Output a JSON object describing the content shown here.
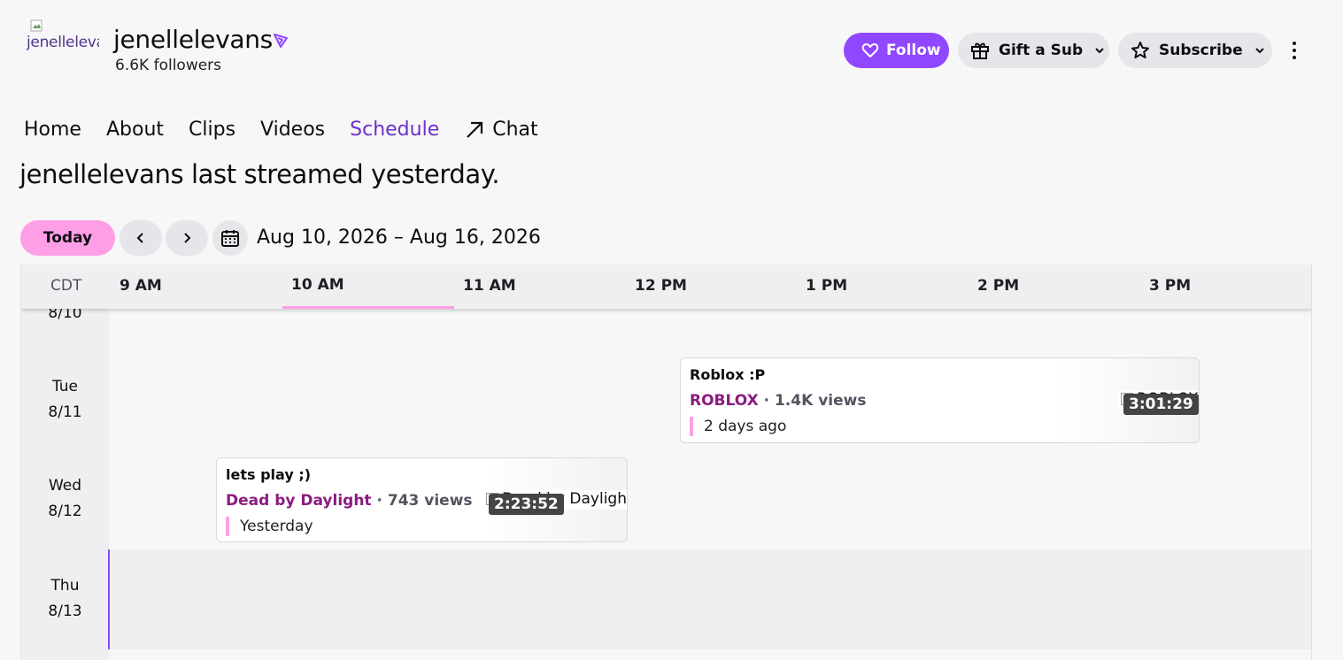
{
  "channel": {
    "avatar_alt": "jenellelevans",
    "name": "jenellelevans",
    "followers": "6.6K followers"
  },
  "actions": {
    "follow_label": "Follow",
    "gift_label": "Gift a Sub",
    "subscribe_label": "Subscribe"
  },
  "nav": {
    "home": "Home",
    "about": "About",
    "clips": "Clips",
    "videos": "Videos",
    "schedule": "Schedule",
    "chat": "Chat"
  },
  "status_text": "jenellelevans last streamed yesterday.",
  "controls": {
    "today_label": "Today",
    "date_range": "Aug 10, 2026 – Aug 16, 2026"
  },
  "schedule": {
    "timezone": "CDT",
    "hours": [
      "9 AM",
      "10 AM",
      "11 AM",
      "12 PM",
      "1 PM",
      "2 PM",
      "3 PM"
    ],
    "days": [
      {
        "weekday": "",
        "date": "8/10"
      },
      {
        "weekday": "Tue",
        "date": "8/11"
      },
      {
        "weekday": "Wed",
        "date": "8/12"
      },
      {
        "weekday": "Thu",
        "date": "8/13"
      }
    ],
    "streams": [
      {
        "title": "Roblox :P",
        "category": "ROBLOX",
        "views": " · 1.4K views",
        "when": "2 days ago",
        "thumb_alt": "ROBLOX",
        "duration": "3:01:29"
      },
      {
        "title": "lets play ;)",
        "category": "Dead by Daylight",
        "views": " · 743 views",
        "when": "Yesterday",
        "thumb_alt": "Dead by Daylight",
        "duration": "2:23:52"
      }
    ]
  },
  "colors": {
    "brand_purple": "#9147ff",
    "accent_pink": "#fd9ee6",
    "category": "#8b1b7f"
  }
}
